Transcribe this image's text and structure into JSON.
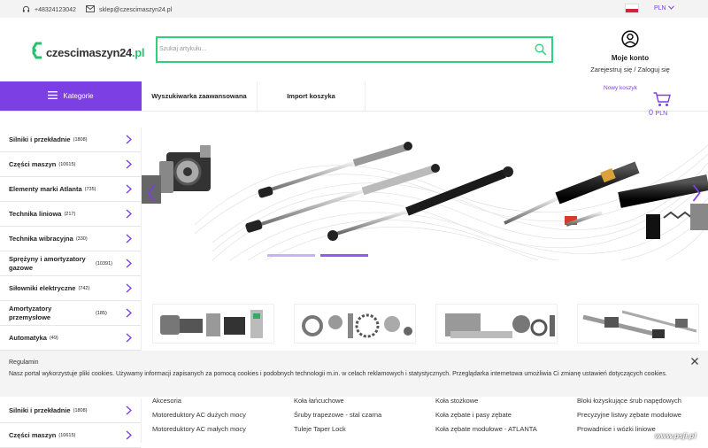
{
  "topbar": {
    "phone": "+48324123042",
    "email": "sklep@czescimaszyn24.pl",
    "currency": "PLN"
  },
  "header": {
    "logo_main": "czescimaszyn24",
    "logo_suffix": ".pl",
    "search_placeholder": "Szukaj artykułu...",
    "account_title": "Moje konto",
    "account_links": "Zarejestruj się / Zaloguj się"
  },
  "nav": {
    "categories": "Kategorie",
    "advanced_search": "Wyszukiwarka zaawansowana",
    "import_cart": "Import koszyka",
    "cart_label": "Nowy koszyk",
    "cart_amount": "0",
    "cart_currency": "PLN"
  },
  "sidebar": [
    {
      "name": "Silniki i przekładnie",
      "count": "(1808)"
    },
    {
      "name": "Części maszyn",
      "count": "(10615)"
    },
    {
      "name": "Elementy marki Atlanta",
      "count": "(735)"
    },
    {
      "name": "Technika liniowa",
      "count": "(217)"
    },
    {
      "name": "Technika wibracyjna",
      "count": "(330)"
    },
    {
      "name": "Sprężyny i amortyzatory gazowe",
      "count": "(10391)"
    },
    {
      "name": "Siłowniki elektryczne",
      "count": "(742)"
    },
    {
      "name": "Amortyzatory przemysłowe",
      "count": "(185)"
    },
    {
      "name": "Automatyka",
      "count": "(49)"
    }
  ],
  "sidebar2": [
    {
      "name": "Silniki i przekładnie",
      "count": "(1808)"
    },
    {
      "name": "Części maszyn",
      "count": "(10615)"
    }
  ],
  "cookie": {
    "title": "Regulamin",
    "text": "Nasz portal wykorzystuje pliki cookies. Używamy informacji zapisanych za pomocą cookies i podobnych technologii m.in. w celach reklamowych i statystycznych. Przeglądarka internetowa umożliwia Ci zmianę ustawień dotyczących cookies."
  },
  "catgrid": [
    [
      "Akcesoria",
      "Motoreduktory AC dużych mocy",
      "Motoreduktory AC małych mocy"
    ],
    [
      "Koła łańcuchowe",
      "Śruby trapezowe - stal czarna",
      "Tuleje Taper Lock"
    ],
    [
      "Koła stożkowe",
      "Koła zębate i pasy zębate",
      "Koła zębate modułowe - ATLANTA"
    ],
    [
      "Bloki łożyskujące śrub napędowych",
      "Precyzyjne listwy zębate modułowe",
      "Prowadnice i wózki liniowe"
    ]
  ],
  "watermark": "www.psji.pl",
  "colors": {
    "accent": "#7b3fe4",
    "search_border": "#2dd27c",
    "logo_green": "#25c26e"
  }
}
